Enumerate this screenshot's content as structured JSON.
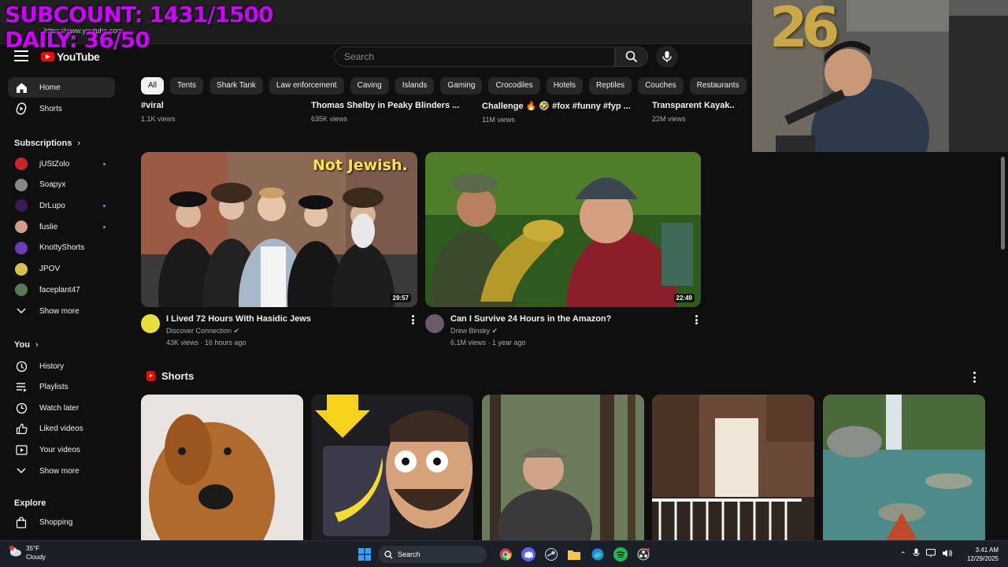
{
  "overlay": {
    "subcount": "SUBCOUNT: 1431/1500",
    "daily": "DAILY: 36/50"
  },
  "browser": {
    "url": "https://www.youtube.com"
  },
  "header": {
    "logo_text": "YouTube",
    "search_placeholder": "Search"
  },
  "chips": [
    "All",
    "Tents",
    "Shark Tank",
    "Law enforcement",
    "Caving",
    "Islands",
    "Gaming",
    "Crocodiles",
    "Hotels",
    "Reptiles",
    "Couches",
    "Restaurants",
    "Mountains"
  ],
  "sidebar": {
    "home": "Home",
    "shorts": "Shorts",
    "subscriptions_head": "Subscriptions",
    "subscriptions": [
      {
        "name": "jUStZolo",
        "color": "#c62828",
        "live_dot": true
      },
      {
        "name": "Soapyx",
        "color": "#888888",
        "live_dot": false
      },
      {
        "name": "DrLupo",
        "color": "#3b1a5a",
        "live_dot": true
      },
      {
        "name": "fuslie",
        "color": "#d49a8a",
        "live_dot": true
      },
      {
        "name": "KnottyShorts",
        "color": "#6a3fb5",
        "live_dot": false
      },
      {
        "name": "JPOV",
        "color": "#d4c24a",
        "live_dot": false
      },
      {
        "name": "faceplant47",
        "color": "#5a7a5a",
        "live_dot": false
      }
    ],
    "show_more": "Show more",
    "you_head": "You",
    "you_items": [
      "History",
      "Playlists",
      "Watch later",
      "Liked videos",
      "Your videos"
    ],
    "show_more_2": "Show more",
    "explore_head": "Explore",
    "shopping": "Shopping"
  },
  "row1": [
    {
      "title": "#viral",
      "views": "1.1K views"
    },
    {
      "title": "Thomas Shelby in Peaky Blinders ...",
      "views": "635K views"
    },
    {
      "title": "Challenge 🔥 🤣 #fox #funny #fyp ...",
      "views": "11M views"
    },
    {
      "title": "Transparent Kayak..",
      "views": "22M views"
    }
  ],
  "videos": [
    {
      "title": "I Lived 72 Hours With Hasidic Jews",
      "channel": "Discover Connection",
      "meta": "43K views · 16 hours ago",
      "duration": "29:57",
      "overlay_text": "Not Jewish."
    },
    {
      "title": "Can I Survive 24 Hours in the Amazon?",
      "channel": "Drew Binsky",
      "meta": "6.1M views · 1 year ago",
      "duration": "22:49"
    }
  ],
  "shorts_section": {
    "title": "Shorts"
  },
  "webcam": {
    "balloon_text": "26"
  },
  "taskbar": {
    "temperature": "35°F",
    "condition": "Cloudy",
    "search": "Search",
    "time": "3:41 AM",
    "date": "12/29/2025"
  },
  "colors": {
    "accent_red": "#ff0000",
    "bg": "#0f0f0f",
    "overlay_purple": "#d000ff"
  }
}
